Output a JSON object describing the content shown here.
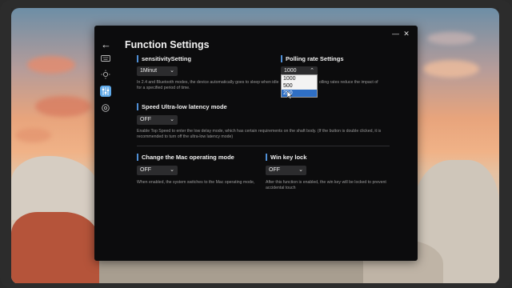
{
  "window": {
    "title": "Function Settings",
    "minimize_icon": "minimize-icon",
    "close_icon": "close-icon"
  },
  "sidebar": {
    "items": [
      {
        "name": "keyboard-icon",
        "active": false
      },
      {
        "name": "lighting-icon",
        "active": false
      },
      {
        "name": "sliders-icon",
        "active": true
      },
      {
        "name": "gear-icon",
        "active": false
      }
    ]
  },
  "sensitivity": {
    "heading": "sensitivitySetting",
    "value": "1Minut",
    "description": "In 2.4 and Bluetooth modes, the device automatically goes to sleep when idle for a specified period of time."
  },
  "polling": {
    "heading": "Polling rate Settings",
    "value": "1000",
    "description_tail": "olling rates reduce the impact of",
    "options": [
      "1000",
      "500",
      "250"
    ],
    "highlighted": "250"
  },
  "speed": {
    "heading": "Speed Ultra-low latency mode",
    "value": "OFF",
    "description": "Enable Top Speed to enter the low delay mode, which has certain requirements on the shaft body. (If the button is double clicked, it is recommended to turn off the ultra-low latency mode)"
  },
  "mac": {
    "heading": "Change the Mac operating mode",
    "value": "OFF",
    "description": "When enabled, the system switches to the Mac operating mode,"
  },
  "winlock": {
    "heading": "Win key lock",
    "value": "OFF",
    "description": "After this function is enabled, the win key will be locked to prevent accidental touch"
  },
  "colors": {
    "accent": "#4f8fd6",
    "panel_bg": "#0c0c0d",
    "select_bg": "#2c2c2e",
    "highlight": "#2f6fc4"
  }
}
